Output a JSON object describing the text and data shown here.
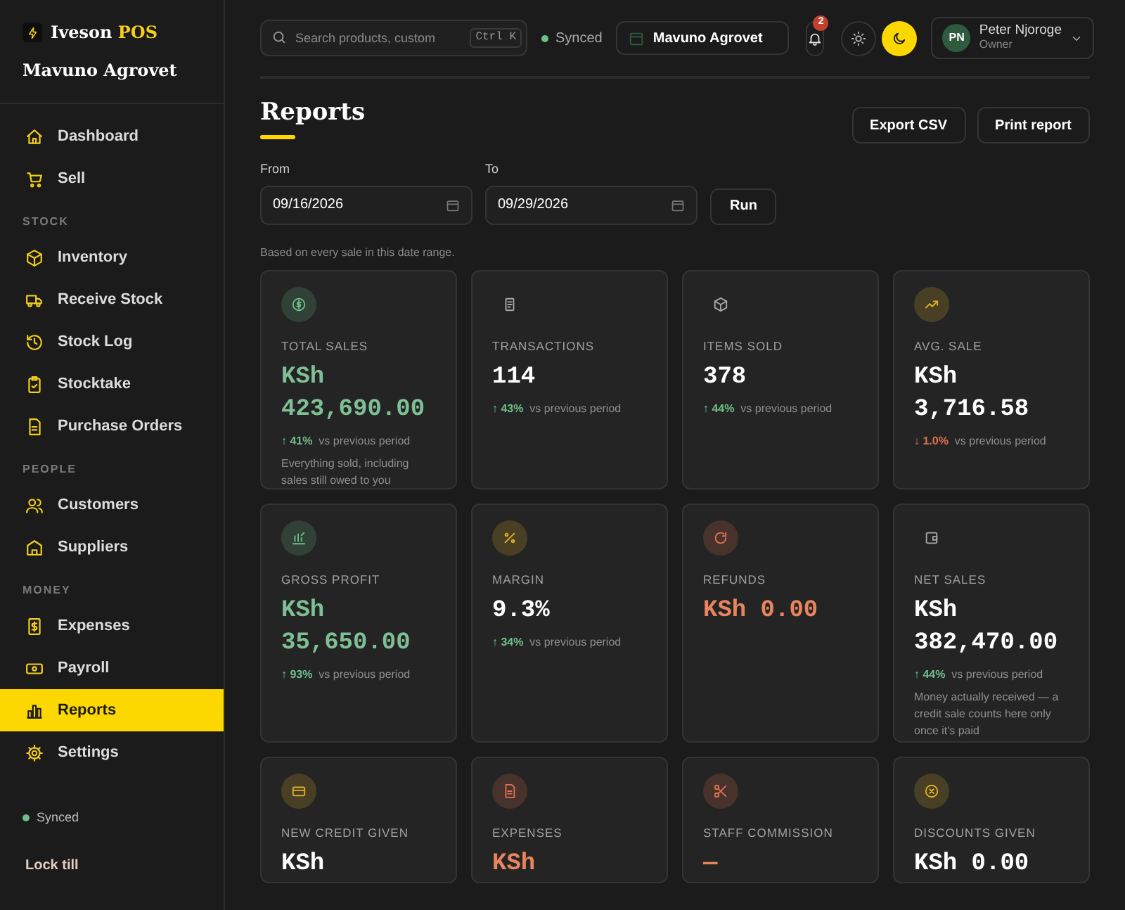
{
  "sidebar": {
    "brand": {
      "name": "Iveson",
      "accent": "POS"
    },
    "org": "Mavuno Agrovet",
    "sections": [
      {
        "items": [
          {
            "label": "Dashboard",
            "selected": false
          },
          {
            "label": "Sell",
            "selected": false
          }
        ]
      },
      {
        "heading": "STOCK",
        "items": [
          {
            "label": "Inventory",
            "selected": false
          },
          {
            "label": "Receive Stock",
            "selected": false
          },
          {
            "label": "Stock Log",
            "selected": false
          },
          {
            "label": "Stocktake",
            "selected": false
          },
          {
            "label": "Purchase Orders",
            "selected": false
          }
        ]
      },
      {
        "heading": "PEOPLE",
        "items": [
          {
            "label": "Customers",
            "selected": false
          },
          {
            "label": "Suppliers",
            "selected": false
          }
        ]
      },
      {
        "heading": "MONEY",
        "items": [
          {
            "label": "Expenses",
            "selected": false
          },
          {
            "label": "Payroll",
            "selected": false
          },
          {
            "label": "Reports",
            "selected": true
          },
          {
            "label": "Settings",
            "selected": false
          }
        ]
      }
    ],
    "sync_status": "Synced",
    "lock": "Lock till"
  },
  "topbar": {
    "search": {
      "placeholder": "Search products, custom",
      "shortcut": "Ctrl K"
    },
    "sync_status": "Synced",
    "store": "Mavuno Agrovet",
    "notifications": "2",
    "dark_mode": true,
    "user": {
      "initials": "PN",
      "name": "Peter Njoroge",
      "role": "Owner"
    }
  },
  "page": {
    "title": "Reports",
    "actions": [
      "Export CSV",
      "Print report"
    ],
    "filters": {
      "from": {
        "label": "From",
        "value": "09/16/2026"
      },
      "to": {
        "label": "To",
        "value": "09/29/2026"
      },
      "run": "Run"
    },
    "note": "Based on every sale in this date range.",
    "cards": [
      {
        "color": "#6fbf8a",
        "label": "TOTAL SALES",
        "value_lines": [
          "KSh",
          "423,690.00"
        ],
        "positive": true,
        "negative": false,
        "delta": {
          "value": "↑ 41%",
          "text": "vs previous period"
        },
        "description": "Everything sold, including sales still owed to you"
      },
      {
        "label": "TRANSACTIONS",
        "value_lines": [
          "114"
        ],
        "positive": false,
        "negative": false,
        "delta": {
          "value": "↑ 43%",
          "text": "vs previous period"
        }
      },
      {
        "label": "ITEMS SOLD",
        "value_lines": [
          "378"
        ],
        "positive": false,
        "negative": false,
        "delta": {
          "value": "↑ 44%",
          "text": "vs previous period"
        }
      },
      {
        "color": "#e3b224",
        "label": "AVG. SALE",
        "value_lines": [
          "KSh",
          "3,716.58"
        ],
        "positive": false,
        "negative": false,
        "delta": {
          "value": "↓ 1.0%",
          "falling": true,
          "text": "vs previous period"
        }
      },
      {
        "color": "#6fbf8a",
        "label": "GROSS PROFIT",
        "value_lines": [
          "KSh",
          "35,650.00"
        ],
        "positive": true,
        "negative": false,
        "delta": {
          "value": "↑ 93%",
          "text": "vs previous period"
        }
      },
      {
        "color": "#e3b224",
        "label": "MARGIN",
        "value_lines": [
          "9.3%"
        ],
        "positive": false,
        "negative": false,
        "delta": {
          "value": "↑ 34%",
          "text": "vs previous period"
        }
      },
      {
        "color": "#e07050",
        "label": "REFUNDS",
        "value_lines": [
          "KSh 0.00"
        ],
        "positive": false,
        "negative": true
      },
      {
        "label": "NET SALES",
        "value_lines": [
          "KSh",
          "382,470.00"
        ],
        "positive": false,
        "negative": false,
        "delta": {
          "value": "↑ 44%",
          "text": "vs previous period"
        },
        "description": "Money actually received — a credit sale counts here only once it's paid"
      },
      {
        "color": "#e3b224",
        "label": "NEW CREDIT GIVEN",
        "value_lines": [
          "KSh"
        ],
        "positive": false,
        "negative": false
      },
      {
        "color": "#e07050",
        "label": "EXPENSES",
        "value_lines": [
          "KSh"
        ],
        "positive": false,
        "negative": true
      },
      {
        "color": "#e07050",
        "label": "STAFF COMMISSION",
        "value_lines": [
          "—"
        ],
        "positive": false,
        "negative": true
      },
      {
        "color": "#e3b224",
        "label": "DISCOUNTS GIVEN",
        "value_lines": [
          "KSh 0.00"
        ],
        "positive": false,
        "negative": false
      }
    ]
  }
}
